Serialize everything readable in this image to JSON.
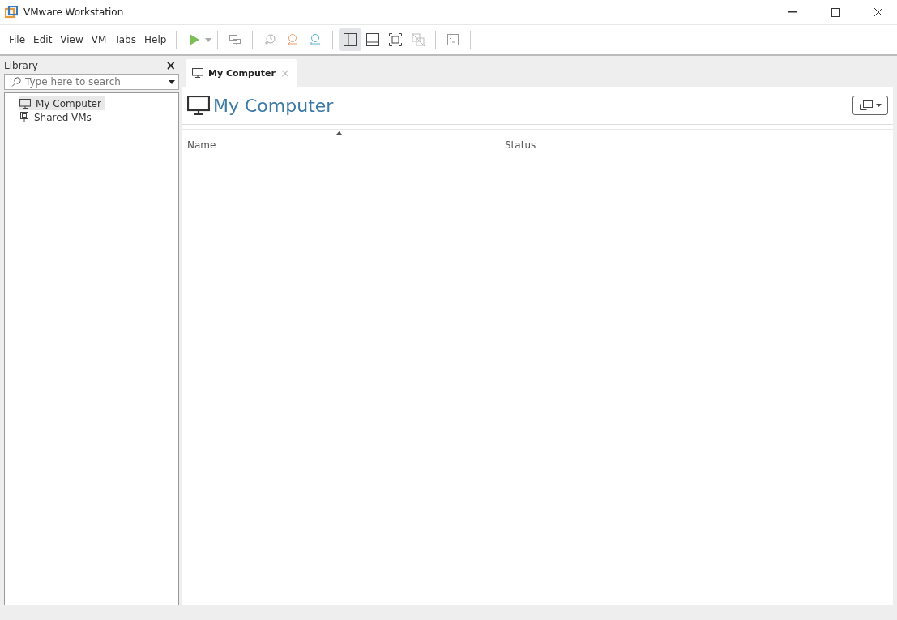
{
  "window": {
    "title": "VMware Workstation"
  },
  "menu": [
    "File",
    "Edit",
    "View",
    "VM",
    "Tabs",
    "Help"
  ],
  "view_buttons": [
    {
      "selected": true
    },
    {
      "selected": false
    },
    {
      "selected": false
    },
    {
      "selected": false
    }
  ],
  "library": {
    "title": "Library",
    "close": "×",
    "search": {
      "placeholder": "Type here to search"
    },
    "items": [
      {
        "label": "My Computer",
        "selected": true
      },
      {
        "label": "Shared VMs",
        "selected": false
      }
    ]
  },
  "tabs": [
    {
      "label": "My Computer",
      "selected": true,
      "close": "×"
    }
  ],
  "page": {
    "title": "My Computer"
  },
  "table": {
    "columns": [
      {
        "label": "Name",
        "sorted": true
      },
      {
        "label": "Status",
        "sorted": false
      }
    ]
  }
}
